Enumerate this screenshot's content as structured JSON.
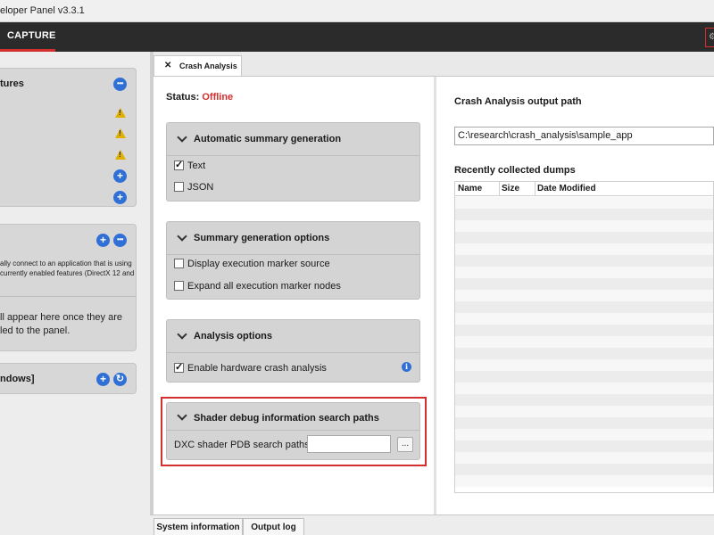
{
  "window": {
    "title": "eloper Panel v3.3.1"
  },
  "nav": {
    "capture_label": "CAPTURE"
  },
  "left": {
    "features_card": {
      "title": "tures"
    },
    "connect_card": {
      "desc_line1": "ally connect to an application that is using",
      "desc_line2": "currently enabled features (DirectX 12 and",
      "info_line1": "ll appear here once they are",
      "info_line2": "led to the panel."
    },
    "windows_card": {
      "title": "ndows]"
    }
  },
  "tab": {
    "label": "Crash Analysis",
    "close": "✕"
  },
  "status": {
    "label": "Status:",
    "value": "Offline"
  },
  "groups": {
    "summary": {
      "title": "Automatic summary generation",
      "options": [
        {
          "label": "Text",
          "checked": true
        },
        {
          "label": "JSON",
          "checked": false
        }
      ]
    },
    "summary_options": {
      "title": "Summary generation options",
      "options": [
        {
          "label": "Display execution marker source",
          "checked": false
        },
        {
          "label": "Expand all execution marker nodes",
          "checked": false
        }
      ]
    },
    "analysis": {
      "title": "Analysis options",
      "options": [
        {
          "label": "Enable hardware crash analysis",
          "checked": true
        }
      ],
      "info_icon": "i"
    },
    "shader": {
      "title": "Shader debug information search paths",
      "field_label": "DXC shader PDB search paths:",
      "field_value": "",
      "browse_label": "..."
    }
  },
  "right": {
    "output_label": "Crash Analysis output path",
    "output_path": "C:\\research\\crash_analysis\\sample_app",
    "dumps_label": "Recently collected dumps",
    "columns": [
      "Name",
      "Size",
      "Date Modified"
    ]
  },
  "bottom": {
    "tabs": [
      "System information",
      "Output log"
    ]
  },
  "colors": {
    "accent": "#d32f2f",
    "info_blue": "#2f6fd6",
    "warning": "#e0b000"
  },
  "icons": [
    "more-icon",
    "warning-icon",
    "add-icon",
    "refresh-icon",
    "gear-icon",
    "chevron-down-icon",
    "info-icon",
    "close-icon"
  ]
}
